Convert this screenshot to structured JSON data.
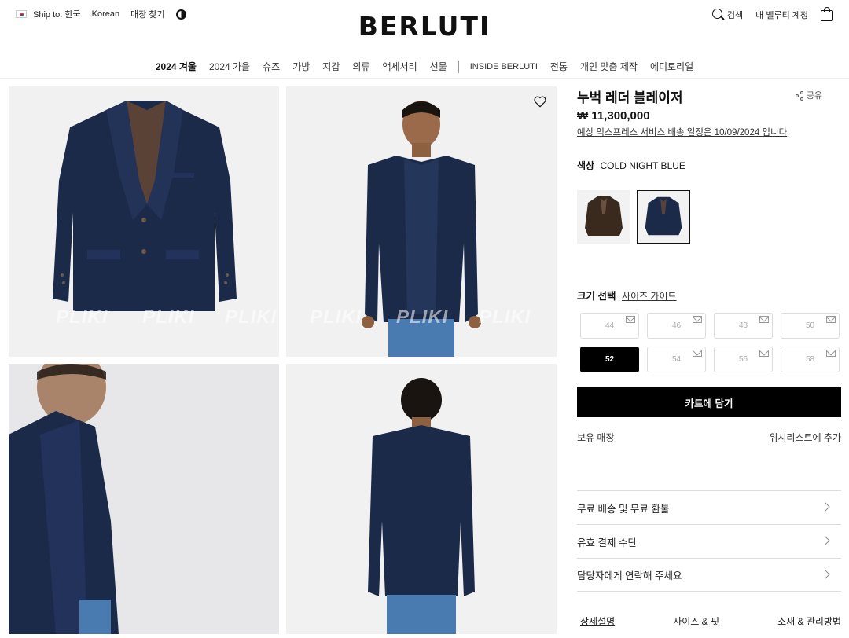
{
  "header": {
    "ship_to": "Ship to: 한국",
    "language": "Korean",
    "store_finder": "매장 찾기",
    "logo": "BERLUTI",
    "search": "검색",
    "account": "내 벨루티 계정"
  },
  "nav": {
    "items": [
      "2024 겨울",
      "2024 가을",
      "슈즈",
      "가방",
      "지갑",
      "의류",
      "액세서리",
      "선물"
    ],
    "items2": [
      "INSIDE BERLUTI",
      "전통",
      "개인 맞춤 제작",
      "에디토리얼"
    ]
  },
  "gallery": {
    "watermark": "PLIKI"
  },
  "product": {
    "title": "누벅 레더 블레이저",
    "share": "공유",
    "price": "₩ 11,300,000",
    "delivery": "예상 익스프레스 서비스 배송 일정은 10/09/2024 입니다",
    "color_label": "색상",
    "color_value": "COLD NIGHT BLUE",
    "size_label": "크기 선택",
    "size_guide": "사이즈 가이드",
    "sizes": [
      "44",
      "46",
      "48",
      "50",
      "52",
      "54",
      "56",
      "58"
    ],
    "selected_size": "52",
    "add_to_cart": "카트에 담기",
    "store_stock": "보유 매장",
    "wishlist": "위시리스트에 추가",
    "accordion": [
      "무료 배송 및 무료 환불",
      "유효 결제 수단",
      "담당자에게 연락해 주세요"
    ],
    "tabs": [
      "상세설명",
      "사이즈 & 핏",
      "소재 & 관리방법"
    ]
  },
  "colors": {
    "navy": "#1c2a4a",
    "brown": "#3a2a1e",
    "denim": "#4a7bb0"
  }
}
